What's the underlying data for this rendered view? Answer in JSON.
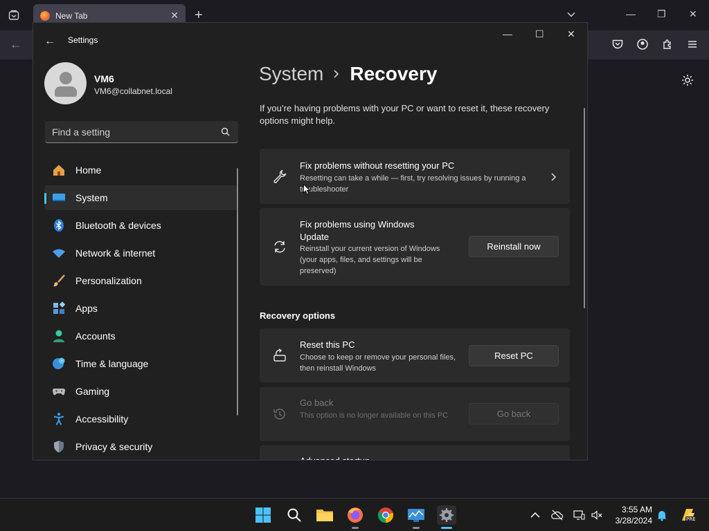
{
  "browser": {
    "tab_title": "New Tab"
  },
  "settings": {
    "window_title": "Settings",
    "user": {
      "name": "VM6",
      "email": "VM6@collabnet.local"
    },
    "search": {
      "placeholder": "Find a setting"
    },
    "nav_items": [
      {
        "label": "Home",
        "icon": "home-icon"
      },
      {
        "label": "System",
        "icon": "system-icon",
        "active": true
      },
      {
        "label": "Bluetooth & devices",
        "icon": "bluetooth-icon"
      },
      {
        "label": "Network & internet",
        "icon": "wifi-icon"
      },
      {
        "label": "Personalization",
        "icon": "brush-icon"
      },
      {
        "label": "Apps",
        "icon": "apps-icon"
      },
      {
        "label": "Accounts",
        "icon": "accounts-icon"
      },
      {
        "label": "Time & language",
        "icon": "globe-clock-icon"
      },
      {
        "label": "Gaming",
        "icon": "gamepad-icon"
      },
      {
        "label": "Accessibility",
        "icon": "accessibility-icon"
      },
      {
        "label": "Privacy & security",
        "icon": "shield-icon"
      }
    ],
    "breadcrumb": {
      "parent": "System",
      "current": "Recovery"
    },
    "intro": "If you’re having problems with your PC or want to reset it, these recovery options might help.",
    "cards": {
      "fix_without_reset": {
        "title": "Fix problems without resetting your PC",
        "desc": "Resetting can take a while — first, try resolving issues by running a troubleshooter"
      },
      "windows_update": {
        "title": "Fix problems using Windows Update",
        "desc": "Reinstall your current version of Windows (your apps, files, and settings will be preserved)",
        "button": "Reinstall now"
      }
    },
    "recovery_options": {
      "heading": "Recovery options",
      "reset_pc": {
        "title": "Reset this PC",
        "desc": "Choose to keep or remove your personal files, then reinstall Windows",
        "button": "Reset PC"
      },
      "go_back": {
        "title": "Go back",
        "desc": "This option is no longer available on this PC",
        "button": "Go back"
      },
      "advanced_startup": {
        "title": "Advanced startup"
      }
    }
  },
  "taskbar": {
    "time": "3:55 AM",
    "date": "3/28/2024",
    "pre_badge": "PRE"
  },
  "colors": {
    "accent": "#4cc2ff",
    "window_bg": "#202020",
    "card_bg": "#2b2b2b"
  }
}
